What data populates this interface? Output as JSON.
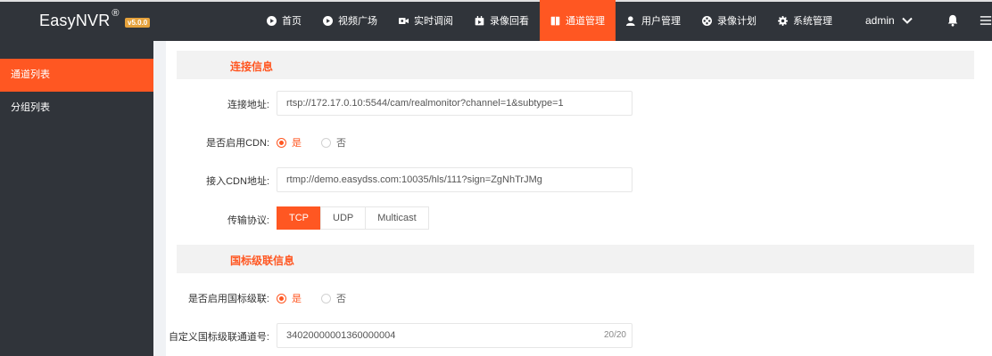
{
  "header": {
    "brand": "EasyNVR",
    "brand_mark": "®",
    "version": "v5.0.0",
    "nav": [
      {
        "label": "首页",
        "icon": "play-circle-icon",
        "active": false
      },
      {
        "label": "视频广场",
        "icon": "play-circle-icon",
        "active": false
      },
      {
        "label": "实时调阅",
        "icon": "video-camera-icon",
        "active": false
      },
      {
        "label": "录像回看",
        "icon": "calendar-icon",
        "active": false
      },
      {
        "label": "通道管理",
        "icon": "book-icon",
        "active": true
      },
      {
        "label": "用户管理",
        "icon": "user-icon",
        "active": false
      },
      {
        "label": "录像计划",
        "icon": "film-reel-icon",
        "active": false
      },
      {
        "label": "系统管理",
        "icon": "gear-icon",
        "active": false
      }
    ],
    "user": "admin",
    "tools": [
      "bell-icon",
      "menu-icon"
    ]
  },
  "sidebar": {
    "items": [
      {
        "label": "通道列表",
        "active": true
      },
      {
        "label": "分组列表",
        "active": false
      }
    ]
  },
  "connection": {
    "title": "连接信息",
    "address_label": "连接地址:",
    "address_value": "rtsp://172.17.0.10:5544/cam/realmonitor?channel=1&subtype=1",
    "cdn_label": "是否启用CDN:",
    "cdn_yes": "是",
    "cdn_no": "否",
    "cdn_enabled": true,
    "cdn_addr_label": "接入CDN地址:",
    "cdn_addr_value": "rtmp://demo.easydss.com:10035/hls/111?sign=ZgNhTrJMg",
    "protocol_label": "传输协议:",
    "protocols": [
      "TCP",
      "UDP",
      "Multicast"
    ],
    "selected_protocol": "TCP"
  },
  "cascade": {
    "title": "国标级联信息",
    "enable_label": "是否启用国标级联:",
    "enable_yes": "是",
    "enable_no": "否",
    "enabled": true,
    "channel_label": "自定义国标级联通道号:",
    "channel_value": "34020000001360000004",
    "channel_count": "20/20"
  },
  "colors": {
    "accent": "#ff5722",
    "topbar": "#30343a",
    "badge": "#e6a23c"
  }
}
